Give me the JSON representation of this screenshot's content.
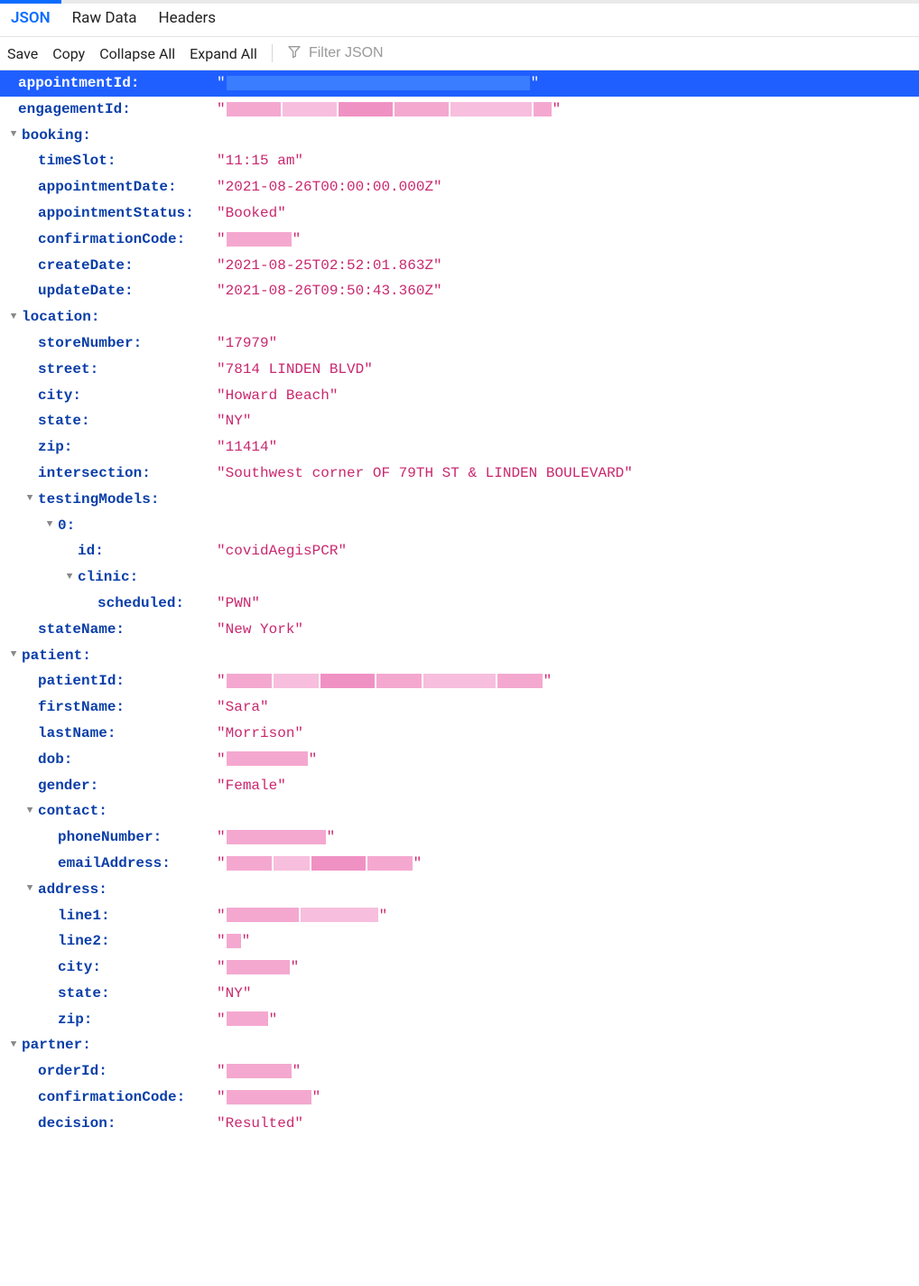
{
  "tabs": {
    "json": "JSON",
    "raw": "Raw Data",
    "headers": "Headers"
  },
  "toolbar": {
    "save": "Save",
    "copy": "Copy",
    "collapseAll": "Collapse All",
    "expandAll": "Expand All",
    "filterPlaceholder": "Filter JSON"
  },
  "colors": {
    "activeTab": "#0a6cff",
    "key": "#0a3ea8",
    "string": "#c9286e",
    "selectedRow": "#1f5fff"
  },
  "rows": [
    {
      "depth": 0,
      "twister": false,
      "key": "appointmentId:",
      "value": {
        "type": "redacted",
        "redactColor": "blue",
        "widths": [
          336
        ]
      },
      "selected": true
    },
    {
      "depth": 0,
      "twister": false,
      "key": "engagementId:",
      "value": {
        "type": "redacted",
        "redactColor": "pink",
        "widths": [
          60,
          60,
          60,
          60,
          90,
          20
        ]
      }
    },
    {
      "depth": 0,
      "twister": true,
      "key": "booking:"
    },
    {
      "depth": 1,
      "twister": false,
      "key": "timeSlot:",
      "value": {
        "type": "string",
        "text": "11:15 am"
      }
    },
    {
      "depth": 1,
      "twister": false,
      "key": "appointmentDate:",
      "value": {
        "type": "string",
        "text": "2021-08-26T00:00:00.000Z"
      }
    },
    {
      "depth": 1,
      "twister": false,
      "key": "appointmentStatus:",
      "value": {
        "type": "string",
        "text": "Booked"
      }
    },
    {
      "depth": 1,
      "twister": false,
      "key": "confirmationCode:",
      "value": {
        "type": "redacted",
        "redactColor": "pink",
        "widths": [
          72
        ]
      }
    },
    {
      "depth": 1,
      "twister": false,
      "key": "createDate:",
      "value": {
        "type": "string",
        "text": "2021-08-25T02:52:01.863Z"
      }
    },
    {
      "depth": 1,
      "twister": false,
      "key": "updateDate:",
      "value": {
        "type": "string",
        "text": "2021-08-26T09:50:43.360Z"
      }
    },
    {
      "depth": 0,
      "twister": true,
      "key": "location:"
    },
    {
      "depth": 1,
      "twister": false,
      "key": "storeNumber:",
      "value": {
        "type": "string",
        "text": "17979"
      }
    },
    {
      "depth": 1,
      "twister": false,
      "key": "street:",
      "value": {
        "type": "string",
        "text": "7814 LINDEN BLVD"
      }
    },
    {
      "depth": 1,
      "twister": false,
      "key": "city:",
      "value": {
        "type": "string",
        "text": "Howard Beach"
      }
    },
    {
      "depth": 1,
      "twister": false,
      "key": "state:",
      "value": {
        "type": "string",
        "text": "NY"
      }
    },
    {
      "depth": 1,
      "twister": false,
      "key": "zip:",
      "value": {
        "type": "string",
        "text": "11414"
      }
    },
    {
      "depth": 1,
      "twister": false,
      "key": "intersection:",
      "value": {
        "type": "string",
        "text": "Southwest corner OF 79TH ST & LINDEN BOULEVARD"
      }
    },
    {
      "depth": 1,
      "twister": true,
      "key": "testingModels:"
    },
    {
      "depth": 2,
      "twister": true,
      "key": "0:"
    },
    {
      "depth": 3,
      "twister": false,
      "key": "id:",
      "value": {
        "type": "string",
        "text": "covidAegisPCR"
      }
    },
    {
      "depth": 3,
      "twister": true,
      "key": "clinic:"
    },
    {
      "depth": 4,
      "twister": false,
      "key": "scheduled:",
      "value": {
        "type": "string",
        "text": "PWN"
      }
    },
    {
      "depth": 1,
      "twister": false,
      "key": "stateName:",
      "value": {
        "type": "string",
        "text": "New York"
      }
    },
    {
      "depth": 0,
      "twister": true,
      "key": "patient:"
    },
    {
      "depth": 1,
      "twister": false,
      "key": "patientId:",
      "value": {
        "type": "redacted",
        "redactColor": "pink",
        "widths": [
          50,
          50,
          60,
          50,
          80,
          50
        ]
      }
    },
    {
      "depth": 1,
      "twister": false,
      "key": "firstName:",
      "value": {
        "type": "string",
        "text": "Sara"
      }
    },
    {
      "depth": 1,
      "twister": false,
      "key": "lastName:",
      "value": {
        "type": "string",
        "text": "Morrison"
      }
    },
    {
      "depth": 1,
      "twister": false,
      "key": "dob:",
      "value": {
        "type": "redacted",
        "redactColor": "pink",
        "widths": [
          90
        ]
      }
    },
    {
      "depth": 1,
      "twister": false,
      "key": "gender:",
      "value": {
        "type": "string",
        "text": "Female"
      }
    },
    {
      "depth": 1,
      "twister": true,
      "key": "contact:"
    },
    {
      "depth": 2,
      "twister": false,
      "key": "phoneNumber:",
      "value": {
        "type": "redacted",
        "redactColor": "pink",
        "widths": [
          110
        ]
      }
    },
    {
      "depth": 2,
      "twister": false,
      "key": "emailAddress:",
      "value": {
        "type": "redacted",
        "redactColor": "pink",
        "widths": [
          50,
          40,
          60,
          50
        ]
      }
    },
    {
      "depth": 1,
      "twister": true,
      "key": "address:"
    },
    {
      "depth": 2,
      "twister": false,
      "key": "line1:",
      "value": {
        "type": "redacted",
        "redactColor": "pink",
        "widths": [
          80,
          86
        ]
      }
    },
    {
      "depth": 2,
      "twister": false,
      "key": "line2:",
      "value": {
        "type": "redacted",
        "redactColor": "pink",
        "widths": [
          16
        ]
      }
    },
    {
      "depth": 2,
      "twister": false,
      "key": "city:",
      "value": {
        "type": "redacted",
        "redactColor": "pink",
        "widths": [
          70
        ]
      }
    },
    {
      "depth": 2,
      "twister": false,
      "key": "state:",
      "value": {
        "type": "string",
        "text": "NY"
      }
    },
    {
      "depth": 2,
      "twister": false,
      "key": "zip:",
      "value": {
        "type": "redacted",
        "redactColor": "pink",
        "widths": [
          46
        ]
      }
    },
    {
      "depth": 0,
      "twister": true,
      "key": "partner:"
    },
    {
      "depth": 1,
      "twister": false,
      "key": "orderId:",
      "value": {
        "type": "redacted",
        "redactColor": "pink",
        "widths": [
          72
        ]
      }
    },
    {
      "depth": 1,
      "twister": false,
      "key": "confirmationCode:",
      "value": {
        "type": "redacted",
        "redactColor": "pink",
        "widths": [
          94
        ]
      }
    },
    {
      "depth": 1,
      "twister": false,
      "key": "decision:",
      "value": {
        "type": "string",
        "text": "Resulted"
      }
    }
  ]
}
